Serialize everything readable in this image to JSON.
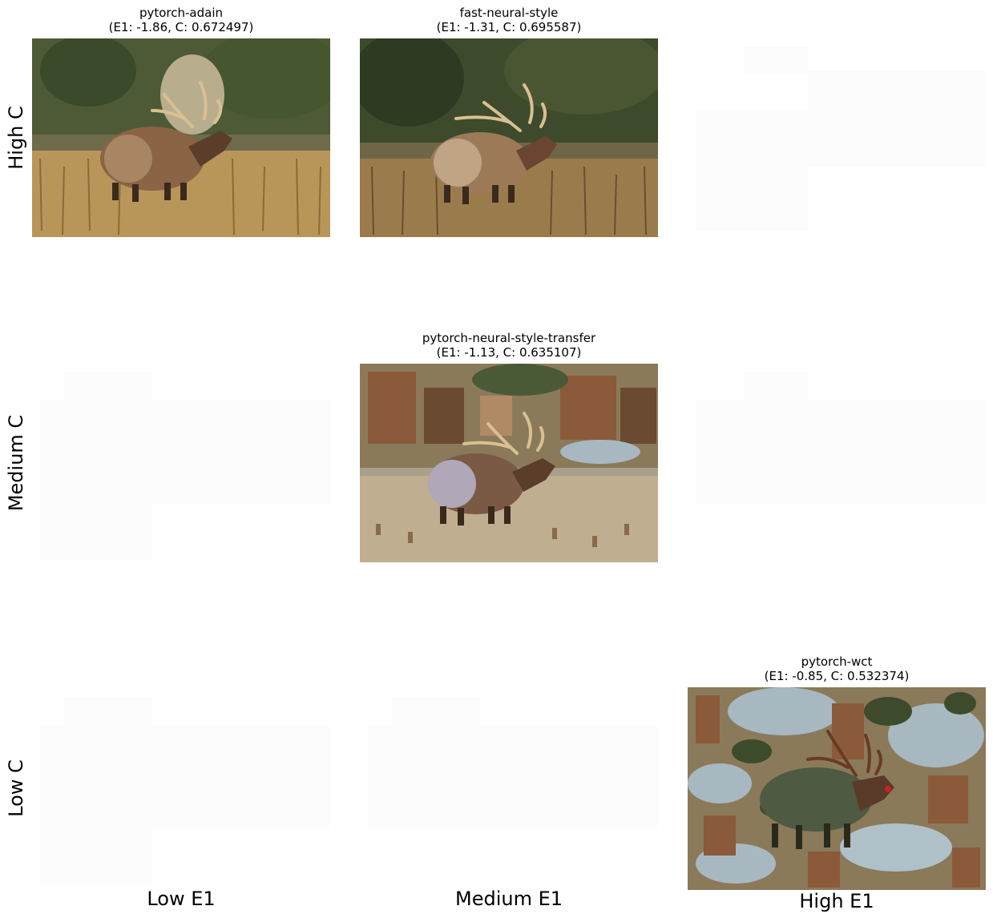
{
  "row_labels": [
    "High C",
    "Medium C",
    "Low C"
  ],
  "col_labels": [
    "Low E1",
    "Medium E1",
    "High E1"
  ],
  "cells": [
    {
      "row": "High C",
      "col": "Low E1",
      "title": "pytorch-adain",
      "stats": "(E1: -1.86, C: 0.672497)",
      "e1": -1.86,
      "c": 0.672497,
      "icon": "elk-stylized-photo"
    },
    {
      "row": "High C",
      "col": "Medium E1",
      "title": "fast-neural-style",
      "stats": "(E1: -1.31, C: 0.695587)",
      "e1": -1.31,
      "c": 0.695587,
      "icon": "elk-stylized-photo"
    },
    {
      "row": "Medium C",
      "col": "Medium E1",
      "title": "pytorch-neural-style-transfer",
      "stats": "(E1: -1.13, C: 0.635107)",
      "e1": -1.13,
      "c": 0.635107,
      "icon": "elk-stylized-photo"
    },
    {
      "row": "Low C",
      "col": "High E1",
      "title": "pytorch-wct",
      "stats": "(E1: -0.85, C: 0.532374)",
      "e1": -0.85,
      "c": 0.532374,
      "icon": "elk-stylized-photo"
    }
  ],
  "empty_cells": [
    {
      "row": "High C",
      "col": "High E1"
    },
    {
      "row": "Medium C",
      "col": "Low E1"
    },
    {
      "row": "Medium C",
      "col": "High E1"
    },
    {
      "row": "Low C",
      "col": "Low E1"
    },
    {
      "row": "Low C",
      "col": "Medium E1"
    }
  ],
  "colors": {
    "grass": "#b8965a",
    "grass_dark": "#7a5a30",
    "trees": "#3d4a2c",
    "elk_body": "#8a6444",
    "elk_dark": "#3a2a1c",
    "antler": "#d8c090",
    "sky_blue": "#a8b8c0",
    "ruins": "#8a5a3a"
  }
}
